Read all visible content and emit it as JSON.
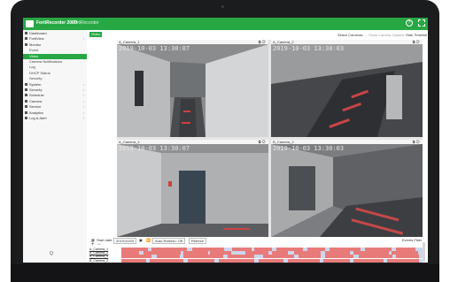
{
  "app": {
    "title": "FortiRecorder 200D",
    "subtitle": "FortiRecorder",
    "help_glyph": "?"
  },
  "sidebar": {
    "items": [
      {
        "label": "Dashboard",
        "icon": "dashboard-icon",
        "level": 0,
        "active": false,
        "chevron": false
      },
      {
        "label": "FortiView",
        "icon": "fortiview-icon",
        "level": 0,
        "active": false,
        "chevron": true
      },
      {
        "label": "Monitor",
        "icon": "monitor-icon",
        "level": 0,
        "active": true,
        "chevron": false
      },
      {
        "label": "Event",
        "icon": "",
        "level": 1,
        "active": false,
        "chevron": false
      },
      {
        "label": "Video",
        "icon": "",
        "level": 1,
        "active": true,
        "chevron": false
      },
      {
        "label": "Camera Notifications",
        "icon": "",
        "level": 1,
        "active": false,
        "chevron": false
      },
      {
        "label": "Log",
        "icon": "",
        "level": 1,
        "active": false,
        "chevron": false
      },
      {
        "label": "DHCP Status",
        "icon": "",
        "level": 1,
        "active": false,
        "chevron": false
      },
      {
        "label": "Security",
        "icon": "",
        "level": 1,
        "active": false,
        "chevron": false
      },
      {
        "label": "System",
        "icon": "system-icon",
        "level": 0,
        "active": false,
        "chevron": true
      },
      {
        "label": "Security",
        "icon": "security-icon",
        "level": 0,
        "active": false,
        "chevron": true
      },
      {
        "label": "Schedule",
        "icon": "schedule-icon",
        "level": 0,
        "active": false,
        "chevron": true
      },
      {
        "label": "Camera",
        "icon": "camera-icon",
        "level": 0,
        "active": false,
        "chevron": true
      },
      {
        "label": "Service",
        "icon": "service-icon",
        "level": 0,
        "active": false,
        "chevron": true
      },
      {
        "label": "Analytics",
        "icon": "analytics-icon",
        "level": 0,
        "active": false,
        "chevron": true
      },
      {
        "label": "Log & Alert",
        "icon": "log-alert-icon",
        "level": 0,
        "active": false,
        "chevron": true
      }
    ],
    "search_glyph": "Q"
  },
  "toolbar": {
    "tab_label": "Video",
    "select_cameras": "Select Cameras",
    "show_options": "Show Camera Options",
    "hide_timeline": "Hide Timeline"
  },
  "cameras": [
    {
      "name": "A_Camera_1",
      "timestamp": "2019-10-03 13:30:07"
    },
    {
      "name": "A_Camera_2",
      "timestamp": "2019-10-03 13:30:03"
    },
    {
      "name": "A_Camera_4",
      "timestamp": "2019-10-03 13:30:07"
    },
    {
      "name": "B_Camera_2",
      "timestamp": "2019-10-03 13:30:03"
    }
  ],
  "timeline": {
    "start_label": "Start date:",
    "start_date": "2019/10/03",
    "auto_refresh": "Auto-Refresh: Off",
    "refresh": "Refresh",
    "events_filter": "Events Filter",
    "zoom_in": "+",
    "zoom_out": "−",
    "rows": [
      {
        "label": "A_Camera_1"
      },
      {
        "label": "A_Camera_2"
      },
      {
        "label": "A_Camera_4"
      },
      {
        "label": "B_Camera_2"
      }
    ]
  },
  "colors": {
    "brand_green": "#27a844",
    "event_segment": "#e87a7a",
    "timeline_track": "#cdd6ea"
  }
}
